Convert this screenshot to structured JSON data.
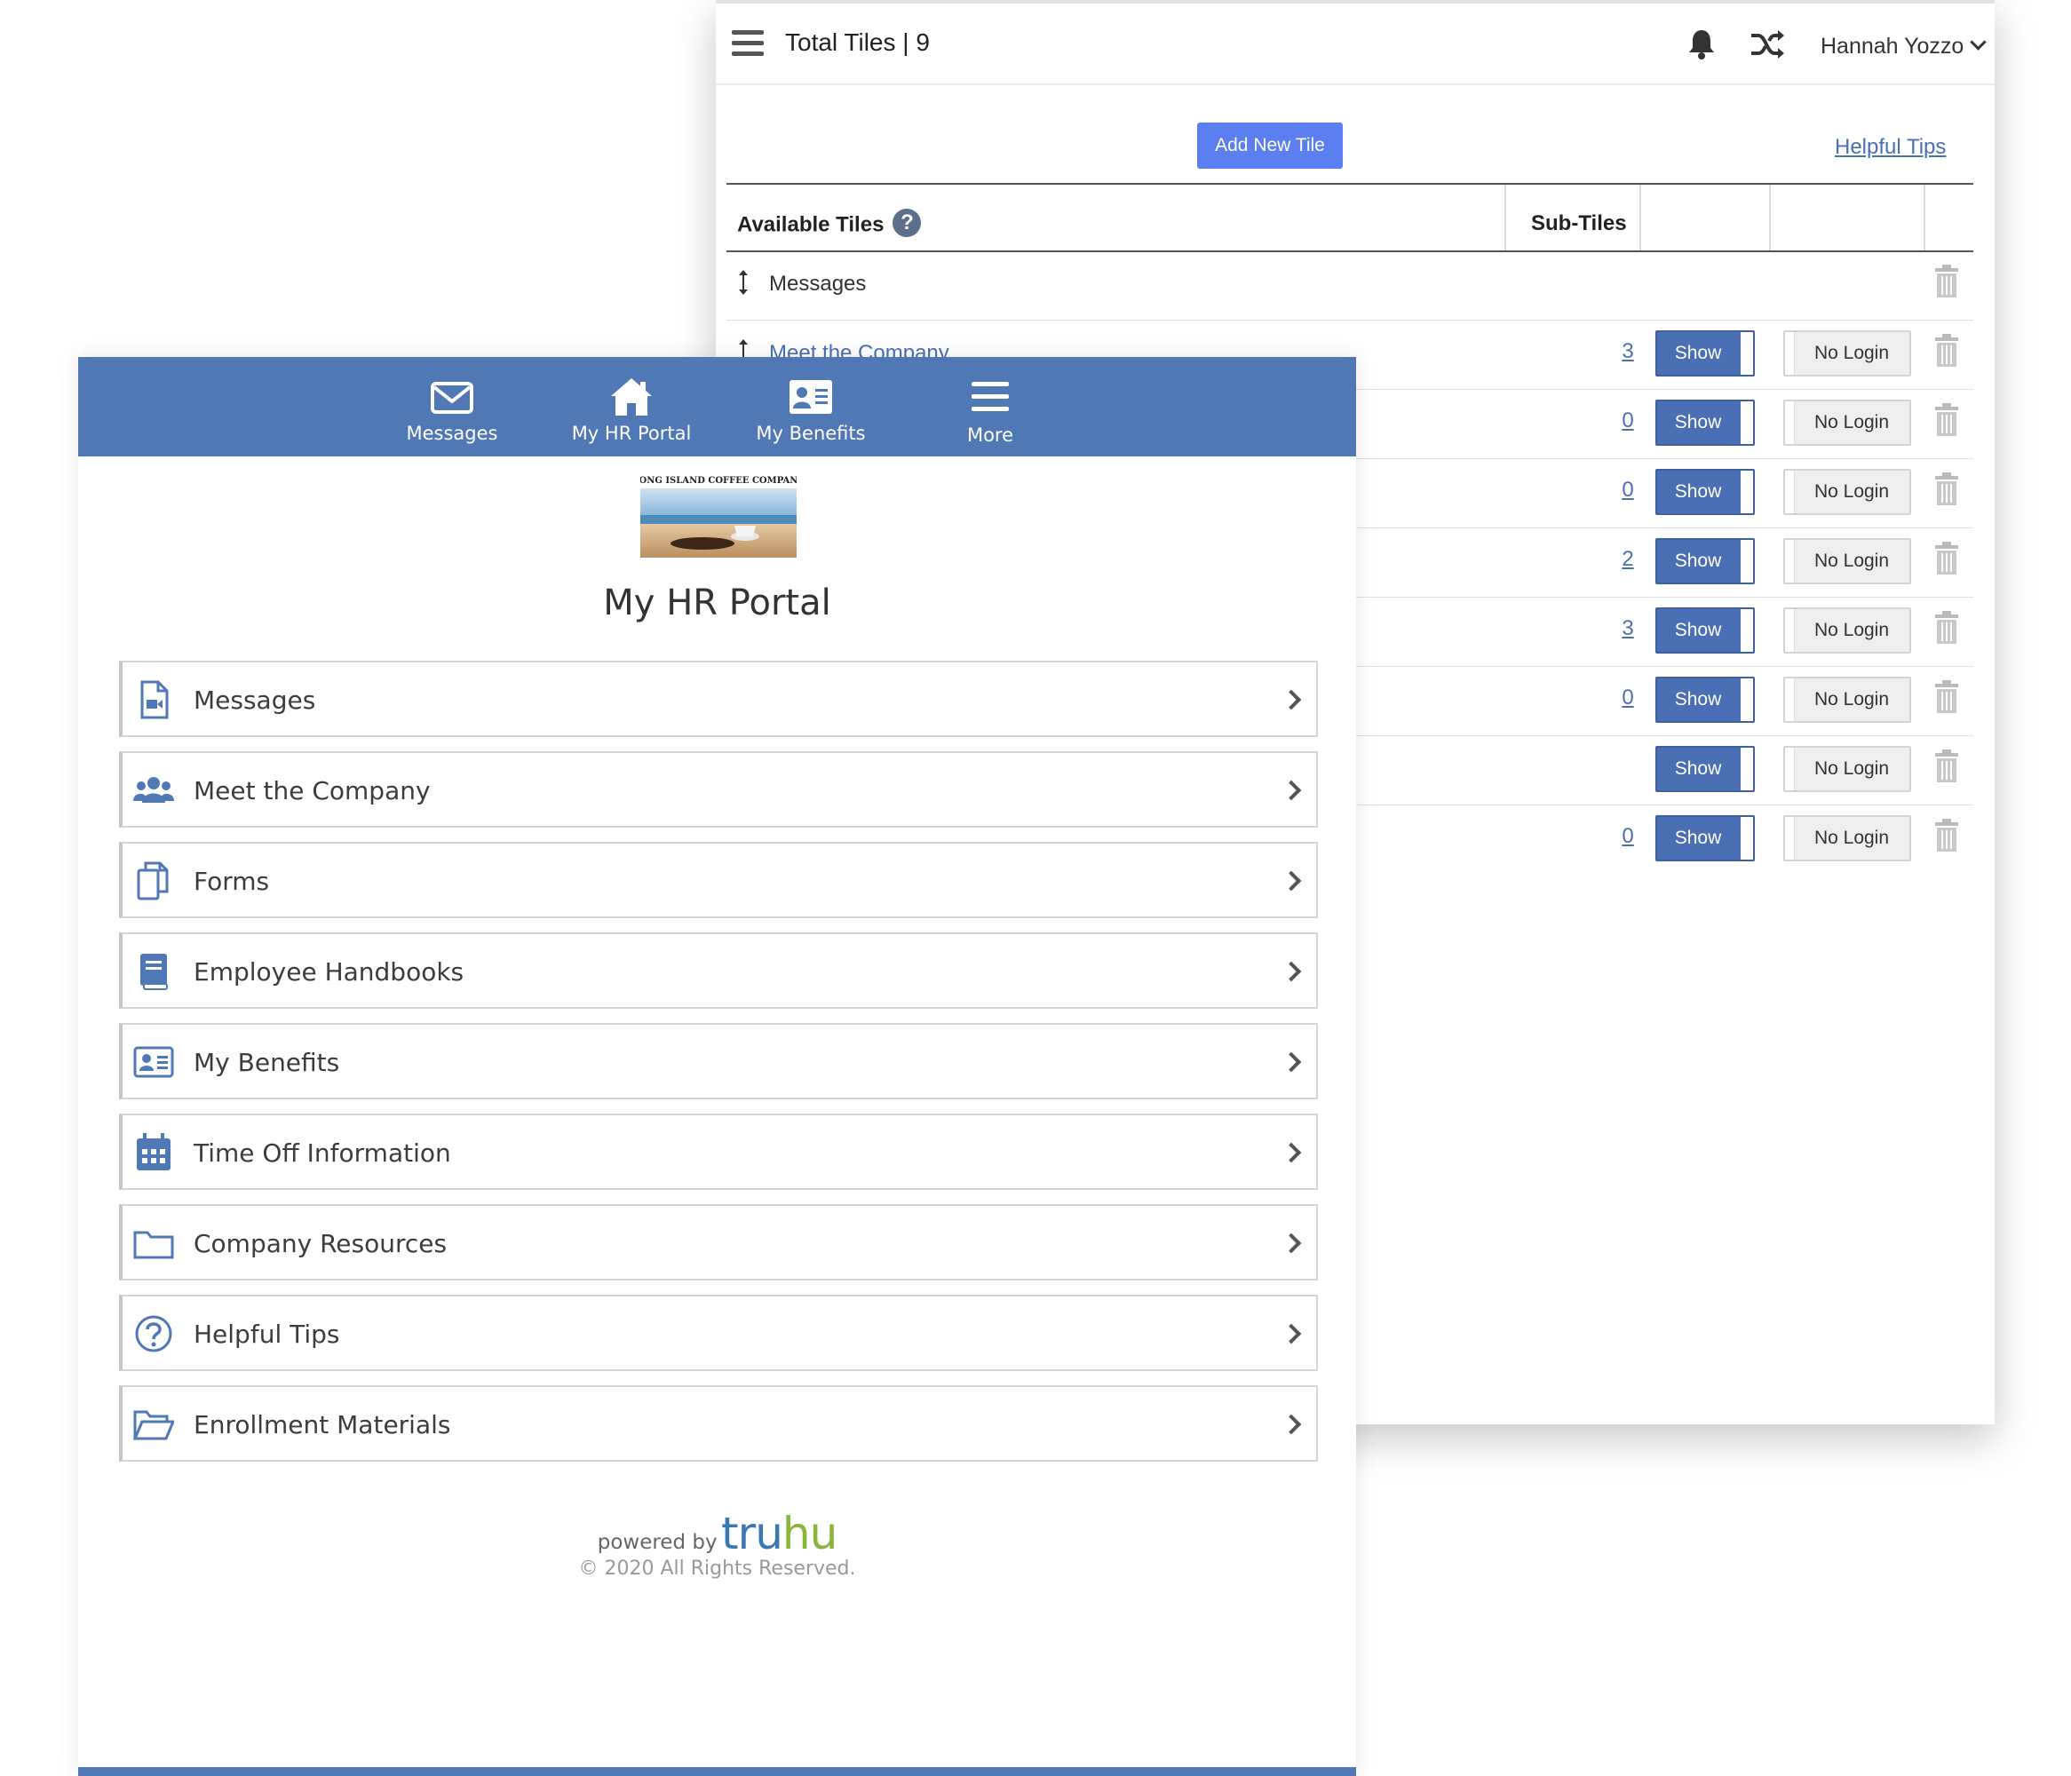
{
  "admin": {
    "title": "Total Tiles | 9",
    "user_name": "Hannah Yozzo",
    "add_button": "Add New Tile",
    "helpful_tips_link": "Helpful Tips",
    "headers": {
      "available": "Available Tiles",
      "help_glyph": "?",
      "subtiles": "Sub-Tiles"
    },
    "rows": [
      {
        "name": "Messages",
        "count": "",
        "show": "",
        "login": ""
      },
      {
        "name": "Meet the Company",
        "count": "3",
        "show": "Show",
        "login": "No Login"
      },
      {
        "name": "",
        "count": "0",
        "show": "Show",
        "login": "No Login"
      },
      {
        "name": "",
        "count": "0",
        "show": "Show",
        "login": "No Login"
      },
      {
        "name": "",
        "count": "2",
        "show": "Show",
        "login": "No Login"
      },
      {
        "name": "",
        "count": "3",
        "show": "Show",
        "login": "No Login"
      },
      {
        "name": "",
        "count": "0",
        "show": "Show",
        "login": "No Login"
      },
      {
        "name": "",
        "count": "",
        "show": "Show",
        "login": "No Login"
      },
      {
        "name": "",
        "count": "0",
        "show": "Show",
        "login": "No Login"
      }
    ],
    "icons": [
      "hamburger-icon",
      "bell-icon",
      "shuffle-icon",
      "chevron-down-icon",
      "drag-handle-icon",
      "trash-icon",
      "help-circle-icon"
    ]
  },
  "mobile": {
    "nav": [
      {
        "label": "Messages",
        "icon": "envelope-icon"
      },
      {
        "label": "My HR Portal",
        "icon": "home-icon"
      },
      {
        "label": "My Benefits",
        "icon": "id-card-icon"
      },
      {
        "label": "More",
        "icon": "hamburger-icon"
      }
    ],
    "logo_text": "LONG ISLAND COFFEE COMPANY",
    "title": "My HR Portal",
    "items": [
      {
        "label": "Messages",
        "icon": "file-video-icon"
      },
      {
        "label": "Meet the Company",
        "icon": "users-icon"
      },
      {
        "label": "Forms",
        "icon": "copy-icon"
      },
      {
        "label": "Employee Handbooks",
        "icon": "book-icon"
      },
      {
        "label": "My Benefits",
        "icon": "id-card-icon"
      },
      {
        "label": "Time Off Information",
        "icon": "calendar-icon"
      },
      {
        "label": "Company Resources",
        "icon": "folder-icon"
      },
      {
        "label": "Helpful Tips",
        "icon": "question-circle-icon"
      },
      {
        "label": "Enrollment Materials",
        "icon": "folder-open-icon"
      }
    ],
    "powered_by": "powered by",
    "brand_a": "tru",
    "brand_b": "hu",
    "copyright": "© 2020 All Rights Reserved."
  },
  "colors": {
    "nav_blue": "#4f78b5",
    "button_blue": "#5b7ef0",
    "toggle_blue": "#4a6fb5",
    "link_blue": "#4a6fb5",
    "brand_green": "#8ab43c"
  }
}
